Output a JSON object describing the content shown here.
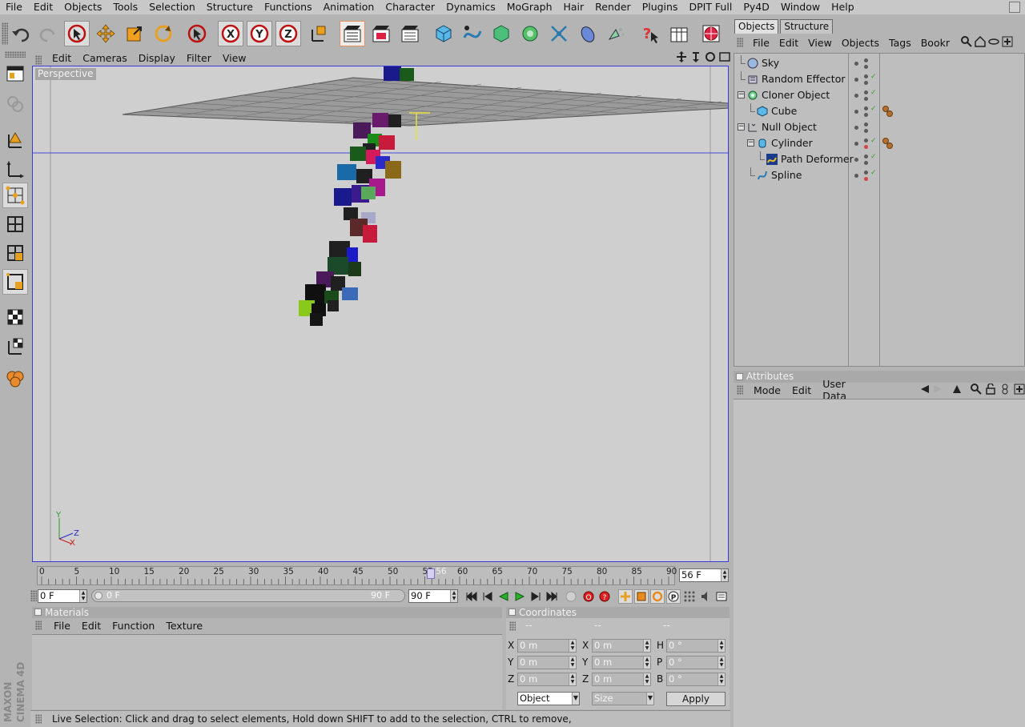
{
  "menubar": [
    "File",
    "Edit",
    "Objects",
    "Tools",
    "Selection",
    "Structure",
    "Functions",
    "Animation",
    "Character",
    "Dynamics",
    "MoGraph",
    "Hair",
    "Render",
    "Plugins",
    "DPIT Full",
    "Py4D",
    "Window",
    "Help"
  ],
  "toolbar_icons": [
    "undo-icon",
    "redo-icon",
    "live-selection-icon",
    "move-icon",
    "scale-icon",
    "rotate-icon",
    "selection-arrow-icon",
    "x-axis-icon",
    "y-axis-icon",
    "z-axis-icon",
    "world-coordinates-icon",
    "render-view-icon",
    "render-picture-viewer-icon",
    "render-settings-icon",
    "cube-primitive-icon",
    "spline-icon",
    "nurbs-icon",
    "array-icon",
    "deformer-icon",
    "scene-icon",
    "camera-icon",
    "light-icon",
    "help-icon",
    "layout-icon",
    "web-icon"
  ],
  "left_tools": [
    "texture-mode-icon",
    "workplane-icon",
    "object-axis-icon",
    "model-axis-icon",
    "points-mode-icon",
    "edges-mode-icon",
    "polygons-mode-icon",
    "animation-mode-icon",
    "texture-axis-icon",
    "uv-edit-icon",
    "sculpt-icon"
  ],
  "brand": [
    "MAXON",
    "CINEMA 4D"
  ],
  "viewport": {
    "menu": [
      "Edit",
      "Cameras",
      "Display",
      "Filter",
      "View"
    ],
    "label": "Perspective",
    "axis_labels": {
      "y": "Y",
      "z": "Z",
      "x": "X"
    }
  },
  "timeline": {
    "ticks": [
      "0",
      "5",
      "10",
      "15",
      "20",
      "25",
      "30",
      "35",
      "40",
      "45",
      "50",
      "55",
      "60",
      "65",
      "70",
      "75",
      "80",
      "85",
      "90"
    ],
    "playhead_label": "56",
    "current_frame": 56,
    "max_frame": 90,
    "current_field": "56 F",
    "start_field": "0 F",
    "range_start": "0 F",
    "range_end": "90 F",
    "end_field": "90 F"
  },
  "materials": {
    "title": "Materials",
    "menu": [
      "File",
      "Edit",
      "Function",
      "Texture"
    ]
  },
  "coordinates": {
    "title": "Coordinates",
    "headers": [
      "--",
      "--",
      "--"
    ],
    "rows": [
      {
        "a": "X",
        "av": "0 m",
        "b": "X",
        "bv": "0 m",
        "c": "H",
        "cv": "0 °"
      },
      {
        "a": "Y",
        "av": "0 m",
        "b": "Y",
        "bv": "0 m",
        "c": "P",
        "cv": "0 °"
      },
      {
        "a": "Z",
        "av": "0 m",
        "b": "Z",
        "bv": "0 m",
        "c": "B",
        "cv": "0 °"
      }
    ],
    "mode_select": "Object",
    "size_select": "Size",
    "apply": "Apply"
  },
  "status": "Live Selection: Click and drag to select elements, Hold down SHIFT to add to the selection, CTRL to remove,",
  "objects_panel": {
    "tabs": [
      "Objects",
      "Structure"
    ],
    "menu": [
      "File",
      "Edit",
      "View",
      "Objects",
      "Tags",
      "Bookr"
    ],
    "items": [
      {
        "name": "Sky",
        "icon": "sky-icon"
      },
      {
        "name": "Random Effector",
        "icon": "effector-icon"
      },
      {
        "name": "Cloner Object",
        "icon": "cloner-icon"
      },
      {
        "name": "Cube",
        "icon": "cube-icon"
      },
      {
        "name": "Null Object",
        "icon": "null-icon"
      },
      {
        "name": "Cylinder",
        "icon": "cylinder-icon"
      },
      {
        "name": "Path Deformer",
        "icon": "path-deformer-icon"
      },
      {
        "name": "Spline",
        "icon": "spline-icon"
      }
    ]
  },
  "attributes": {
    "title": "Attributes",
    "menu": [
      "Mode",
      "Edit",
      "User Data"
    ]
  },
  "colors": {
    "viewport_border": "#3a3ad8",
    "selection_orange": "#e6905a",
    "accent_blue": "#3a9ad8"
  }
}
